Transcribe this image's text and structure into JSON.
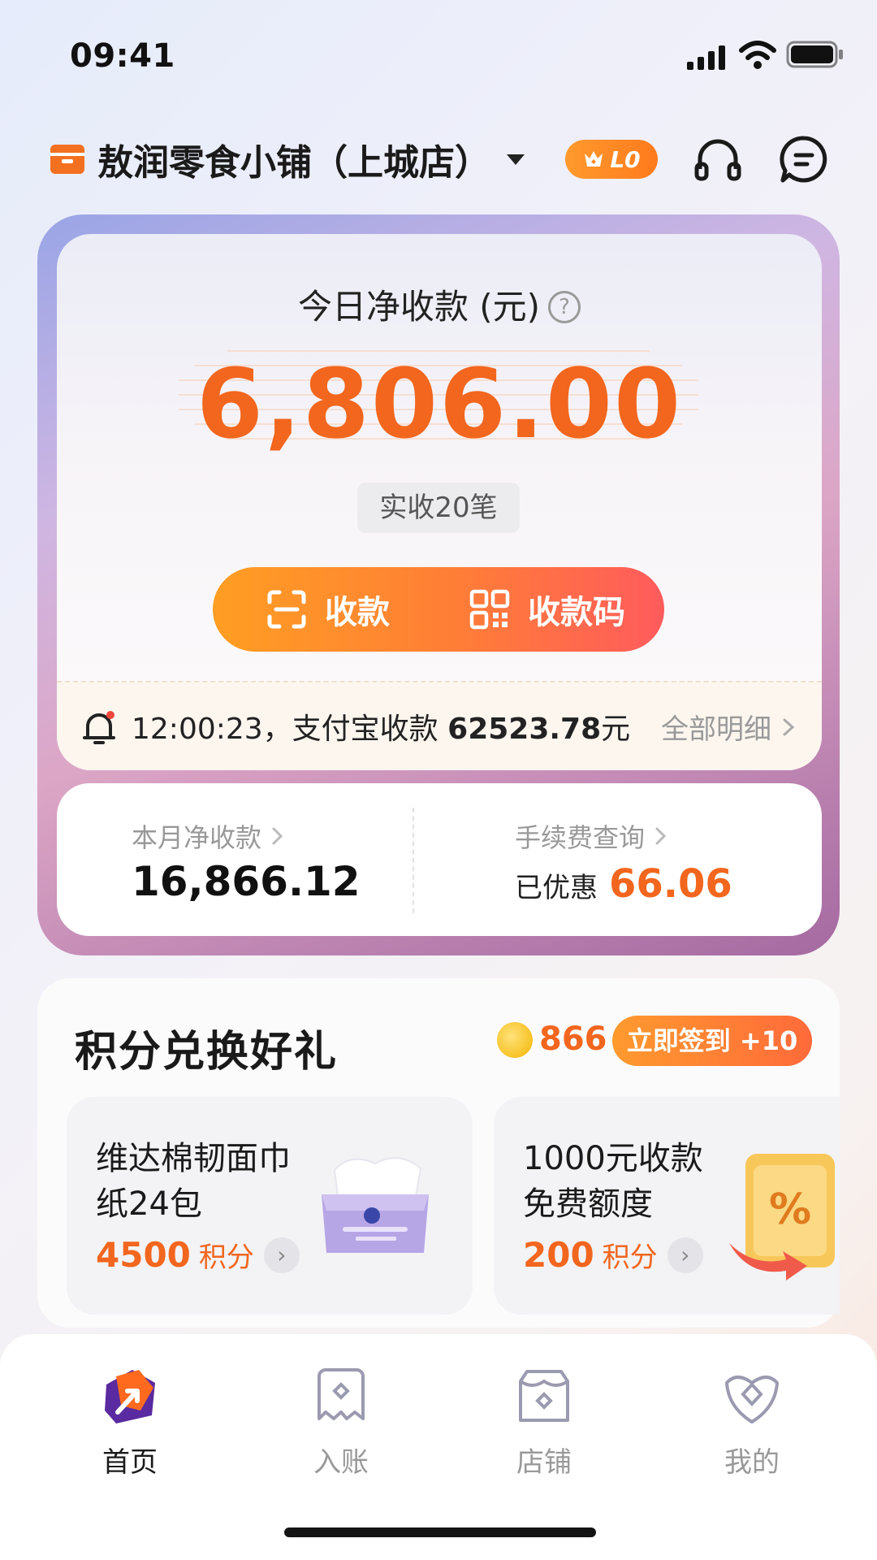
{
  "status_bar": {
    "time": "09:41"
  },
  "header": {
    "store_name": "敖润零食小铺（上城店）",
    "level": "L0",
    "icons": [
      "store-icon",
      "caret-down-icon",
      "customer-service-icon",
      "message-icon"
    ]
  },
  "today": {
    "label": "今日净收款 (元)",
    "help_icon": "?",
    "amount": "6,806.00",
    "count": "实收20笔",
    "collect_label": "收款",
    "qrcode_label": "收款码"
  },
  "notice": {
    "text": "12:00:23，支付宝收款",
    "amount": "62523.78",
    "unit": "元",
    "detail_link": "全部明细"
  },
  "month": {
    "net_label": "本月净收款",
    "net_value": "16,866.12",
    "fee_label": "手续费查询",
    "saved_prefix": "已优惠",
    "saved_value": "66.06"
  },
  "points": {
    "title": "积分兑换好礼",
    "balance": "866",
    "signin_label": "立即签到 +10",
    "products": [
      {
        "name_line1": "维达棉韧面巾",
        "name_line2": "纸24包",
        "points": "4500",
        "unit": "积分"
      },
      {
        "name_line1": "1000元收款",
        "name_line2": "免费额度",
        "points": "200",
        "unit": "积分"
      }
    ]
  },
  "tabbar": {
    "items": [
      {
        "label": "首页",
        "active": true
      },
      {
        "label": "入账",
        "active": false
      },
      {
        "label": "店铺",
        "active": false
      },
      {
        "label": "我的",
        "active": false
      }
    ]
  },
  "colors": {
    "accent": "#f2661e",
    "gradient_start": "#ff9e22",
    "gradient_end": "#ff5b5d",
    "brand_purple": "#5a2aa0"
  }
}
